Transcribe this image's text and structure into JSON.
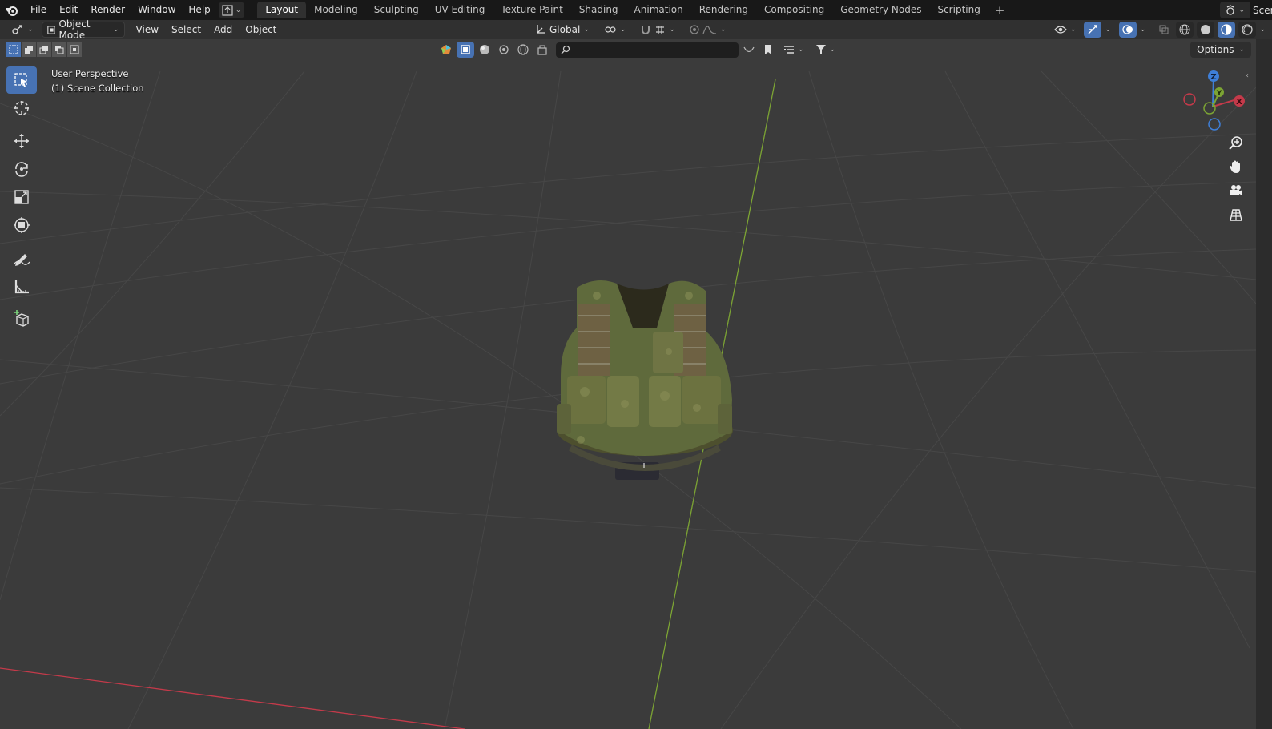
{
  "topbar": {
    "menus": [
      "File",
      "Edit",
      "Render",
      "Window",
      "Help"
    ],
    "workspaces": [
      "Layout",
      "Modeling",
      "Sculpting",
      "UV Editing",
      "Texture Paint",
      "Shading",
      "Animation",
      "Rendering",
      "Compositing",
      "Geometry Nodes",
      "Scripting"
    ],
    "active_workspace": "Layout",
    "add_tab": "+",
    "scene_label": "Scen"
  },
  "header": {
    "mode": "Object Mode",
    "menus": [
      "View",
      "Select",
      "Add",
      "Object"
    ],
    "transform_orientation": "Global"
  },
  "viewport": {
    "options_label": "Options",
    "search_placeholder": "",
    "view_name": "User Perspective",
    "collection": "(1) Scene Collection",
    "gizmo": {
      "x": "X",
      "y": "Y",
      "z": "Z"
    }
  },
  "icons": {
    "logo": "blender-logo-icon",
    "tools": [
      "select-box-icon",
      "cursor-icon",
      "move-icon",
      "rotate-icon",
      "scale-icon",
      "transform-icon",
      "annotate-icon",
      "measure-icon",
      "add-cube-icon"
    ],
    "nav": [
      "zoom-icon",
      "pan-hand-icon",
      "camera-icon",
      "grid-ortho-icon"
    ]
  },
  "colors": {
    "accent": "#4772b3",
    "viewport_bg": "#3b3b3b",
    "x_axis": "#c43a4a",
    "y_axis": "#7ca434",
    "z_axis": "#3e7fd8"
  }
}
